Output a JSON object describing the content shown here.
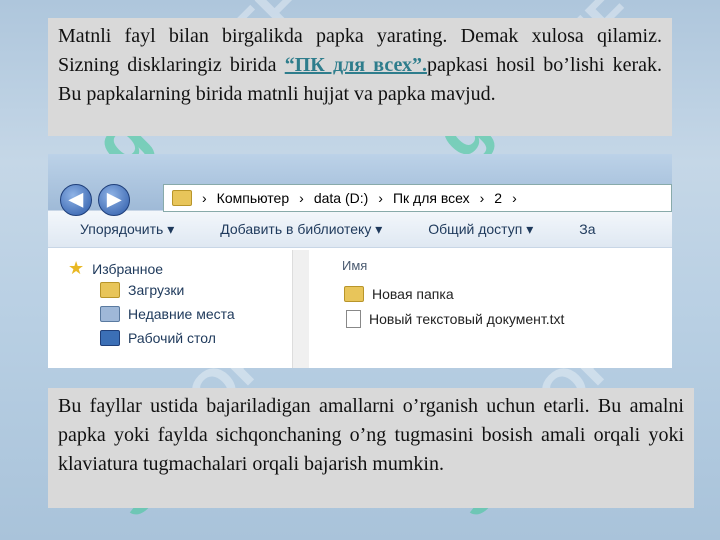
{
  "top_text": {
    "before": "Matnli fayl bilan birgalikda papka yarating. Demak xulosa qilamiz. Sizning disklaringiz birida ",
    "link": "“ПК для всех”.",
    "after": "papkasi hosil bo’lishi kerak. Bu papkalarning birida matnli hujjat va papka mavjud."
  },
  "bottom_text": "Bu fayllar ustida bajariladigan amallarni o’rganish uchun etarli. Bu amalni papka yoki faylda sichqonchaning o’ng tugmasini bosish amali orqali yoki klaviatura tugmachalari orqali bajarish mumkin.",
  "explorer": {
    "breadcrumb": [
      "Компьютер",
      "data (D:)",
      "Пк для всех",
      "2"
    ],
    "toolbar": [
      "Упорядочить ▾",
      "Добавить в библиотеку ▾",
      "Общий доступ ▾",
      "За"
    ],
    "nav_items": [
      "Избранное",
      "Загрузки",
      "Недавние места",
      "Рабочий стол"
    ],
    "column_header": "Имя",
    "files": [
      "Новая папка",
      "Новый текстовый документ.txt"
    ],
    "back_glyph": "◀",
    "forward_glyph": "▶"
  }
}
